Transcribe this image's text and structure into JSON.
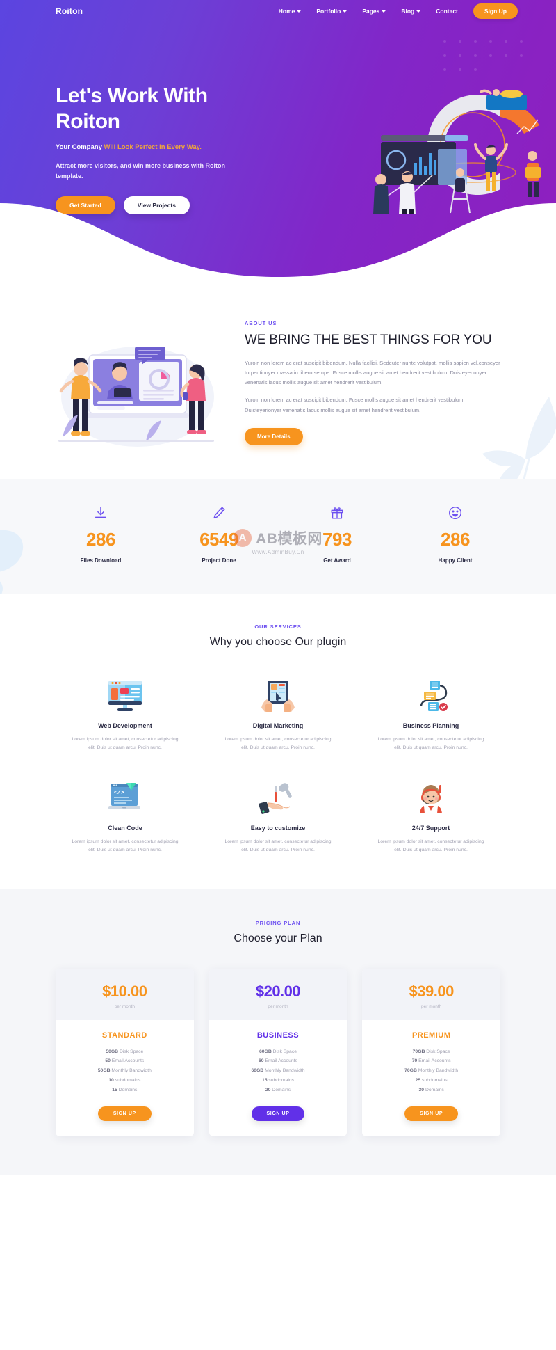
{
  "colors": {
    "brand_purple": "#6c4ff0",
    "brand_orange": "#f7941e",
    "hero_gradient_start": "#5b45e0",
    "hero_gradient_end": "#8f1fbe",
    "heading": "#1f1f2e",
    "muted_text": "#a0a0b0"
  },
  "nav": {
    "logo": "Roiton",
    "items": [
      {
        "label": "Home",
        "has_dropdown": true
      },
      {
        "label": "Portfolio",
        "has_dropdown": true
      },
      {
        "label": "Pages",
        "has_dropdown": true
      },
      {
        "label": "Blog",
        "has_dropdown": true
      },
      {
        "label": "Contact",
        "has_dropdown": false
      }
    ],
    "signup_label": "Sign Up"
  },
  "hero": {
    "title_line1": "Let's Work With",
    "title_line2": "Roiton",
    "subtitle_plain": "Your Company ",
    "subtitle_accent": "Will Look Perfect In Every Way.",
    "description": "Attract more visitors, and win more business with Roiton template.",
    "primary_button": "Get Started",
    "secondary_button": "View Projects",
    "illustration_name": "business-analytics-illustration"
  },
  "about": {
    "eyebrow": "ABOUT US",
    "heading": "WE BRING THE BEST THINGS FOR YOU",
    "paragraph1": "Yuroin non lorem ac erat suscipit bibendum. Nulla facilisi. Sedeuter nunte volutpat, mollis sapien vel,conseyer turpeutionyer massa in libero sempe. Fusce mollis augue sit amet hendrerit vestibulum. Duisteyerionyer venenatis lacus mollis augue sit amet hendrerit vestibulum.",
    "paragraph2": "Yuroin non lorem ac erat suscipit bibendum. Fusce mollis augue sit amet hendrerit vestibulum. Duisteyerionyer venenatis lacus mollis augue sit amet hendrerit vestibulum.",
    "button": "More Details",
    "illustration_name": "team-video-conference-illustration"
  },
  "stats": {
    "watermark_logo_letter": "A",
    "watermark_text": "AB模板网",
    "watermark_sub": "Www.AdminBuy.Cn",
    "items": [
      {
        "icon": "download-icon",
        "value": "286",
        "label": "Files Download"
      },
      {
        "icon": "pencil-icon",
        "value": "6549",
        "label": "Project Done"
      },
      {
        "icon": "gift-icon",
        "value": "793",
        "label": "Get Award"
      },
      {
        "icon": "smiley-icon",
        "value": "286",
        "label": "Happy Client"
      }
    ]
  },
  "services": {
    "eyebrow": "OUR SERVICES",
    "title": "Why you choose Our plugin",
    "items": [
      {
        "icon": "monitor-webpage-icon",
        "title": "Web Development",
        "desc": "Lorem ipsum dolor sit amet, consectetur adipiscing elit. Duis ut quam arcu. Proin nunc."
      },
      {
        "icon": "tablet-hands-icon",
        "title": "Digital Marketing",
        "desc": "Lorem ipsum dolor sit amet, consectetur adipiscing elit. Duis ut quam arcu. Proin nunc."
      },
      {
        "icon": "flowchart-icon",
        "title": "Business Planning",
        "desc": "Lorem ipsum dolor sit amet, consectetur adipiscing elit. Duis ut quam arcu. Proin nunc."
      },
      {
        "icon": "laptop-code-icon",
        "title": "Clean Code",
        "desc": "Lorem ipsum dolor sit amet, consectetur adipiscing elit. Duis ut quam arcu. Proin nunc."
      },
      {
        "icon": "hand-tools-icon",
        "title": "Easy to customize",
        "desc": "Lorem ipsum dolor sit amet, consectetur adipiscing elit. Duis ut quam arcu. Proin nunc."
      },
      {
        "icon": "support-agent-icon",
        "title": "24/7 Support",
        "desc": "Lorem ipsum dolor sit amet, consectetur adipiscing elit. Duis ut quam arcu. Proin nunc."
      }
    ]
  },
  "pricing": {
    "eyebrow": "PRICING PLAN",
    "title": "Choose your Plan",
    "plans": [
      {
        "price": "$10.00",
        "period": "per month",
        "name": "STANDARD",
        "color": "#f7941e",
        "button": "SIGN UP",
        "features": [
          {
            "value": "50GB",
            "text": " Disk Space"
          },
          {
            "value": "50",
            "text": " Email Accounts"
          },
          {
            "value": "50GB",
            "text": " Monthly Bandwidth"
          },
          {
            "value": "10",
            "text": " subdomains"
          },
          {
            "value": "15",
            "text": " Domains"
          }
        ]
      },
      {
        "price": "$20.00",
        "period": "per month",
        "name": "BUSINESS",
        "color": "#6130e8",
        "button": "SIGN UP",
        "features": [
          {
            "value": "60GB",
            "text": " Disk Space"
          },
          {
            "value": "60",
            "text": " Email Accounts"
          },
          {
            "value": "60GB",
            "text": " Monthly Bandwidth"
          },
          {
            "value": "15",
            "text": " subdomains"
          },
          {
            "value": "20",
            "text": " Domains"
          }
        ]
      },
      {
        "price": "$39.00",
        "period": "per month",
        "name": "PREMIUM",
        "color": "#f7941e",
        "button": "SIGN UP",
        "features": [
          {
            "value": "70GB",
            "text": " Disk Space"
          },
          {
            "value": "70",
            "text": " Email Accounts"
          },
          {
            "value": "70GB",
            "text": " Monthly Bandwidth"
          },
          {
            "value": "25",
            "text": " subdomains"
          },
          {
            "value": "30",
            "text": " Domains"
          }
        ]
      }
    ]
  }
}
